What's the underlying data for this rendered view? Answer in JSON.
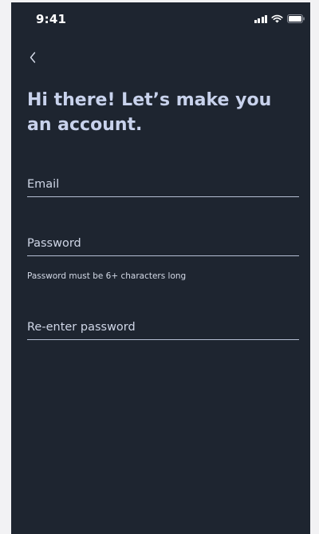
{
  "status_bar": {
    "time": "9:41",
    "icons": [
      "signal-icon",
      "wifi-icon",
      "battery-icon"
    ]
  },
  "header": {
    "back_icon": "chevron-left-icon",
    "title": "Hi there! Let’s make you an account."
  },
  "form": {
    "email": {
      "placeholder": "Email",
      "value": ""
    },
    "password": {
      "placeholder": "Password",
      "value": "",
      "helper": "Password must be 6+ characters long"
    },
    "reenter_password": {
      "placeholder": "Re-enter password",
      "value": ""
    }
  },
  "colors": {
    "background": "#1e2530",
    "title": "#c8d2ec",
    "field_underline": "#b5bed3",
    "page_backdrop": "#f2f2f4"
  }
}
